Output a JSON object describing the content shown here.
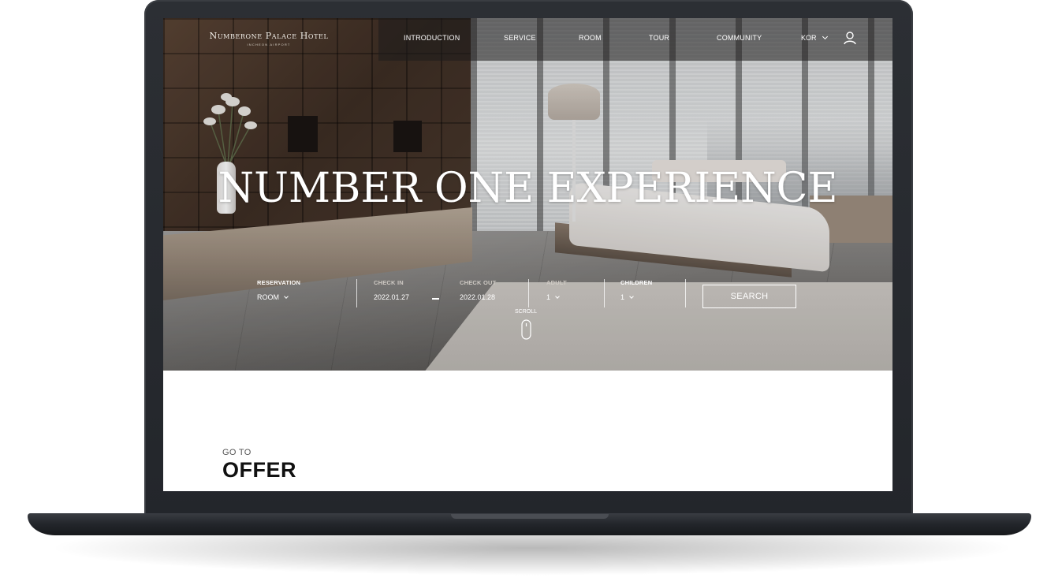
{
  "header": {
    "logo_name": "Numberone Palace Hotel",
    "logo_sub": "INCHEON AIRPORT",
    "nav": [
      "INTRODUCTION",
      "SERVICE",
      "ROOM",
      "TOUR",
      "COMMUNITY"
    ],
    "language": "KOR",
    "icons": {
      "language_chevron": "chevron-down-icon",
      "account": "user-icon"
    }
  },
  "hero": {
    "headline": "NUMBER ONE EXPERIENCE"
  },
  "booking": {
    "reservation_label": "RESERVATION",
    "reservation_value": "ROOM",
    "checkin_label": "CHECK IN",
    "checkin_value": "2022.01.27",
    "checkout_label": "CHECK OUT",
    "checkout_value": "2022.01.28",
    "adult_label": "ADULT",
    "adult_value": "1",
    "children_label": "CHILDREN",
    "children_value": "1",
    "search_label": "SEARCH"
  },
  "scroll": {
    "label": "SCROLL",
    "icon": "mouse-scroll-icon"
  },
  "section": {
    "kicker": "GO TO",
    "title": "OFFER"
  },
  "colors": {
    "frame": "#2c2f34",
    "nav_overlay": "#1e1c1b",
    "text_on_hero": "#ffffff",
    "section_title": "#111111"
  }
}
